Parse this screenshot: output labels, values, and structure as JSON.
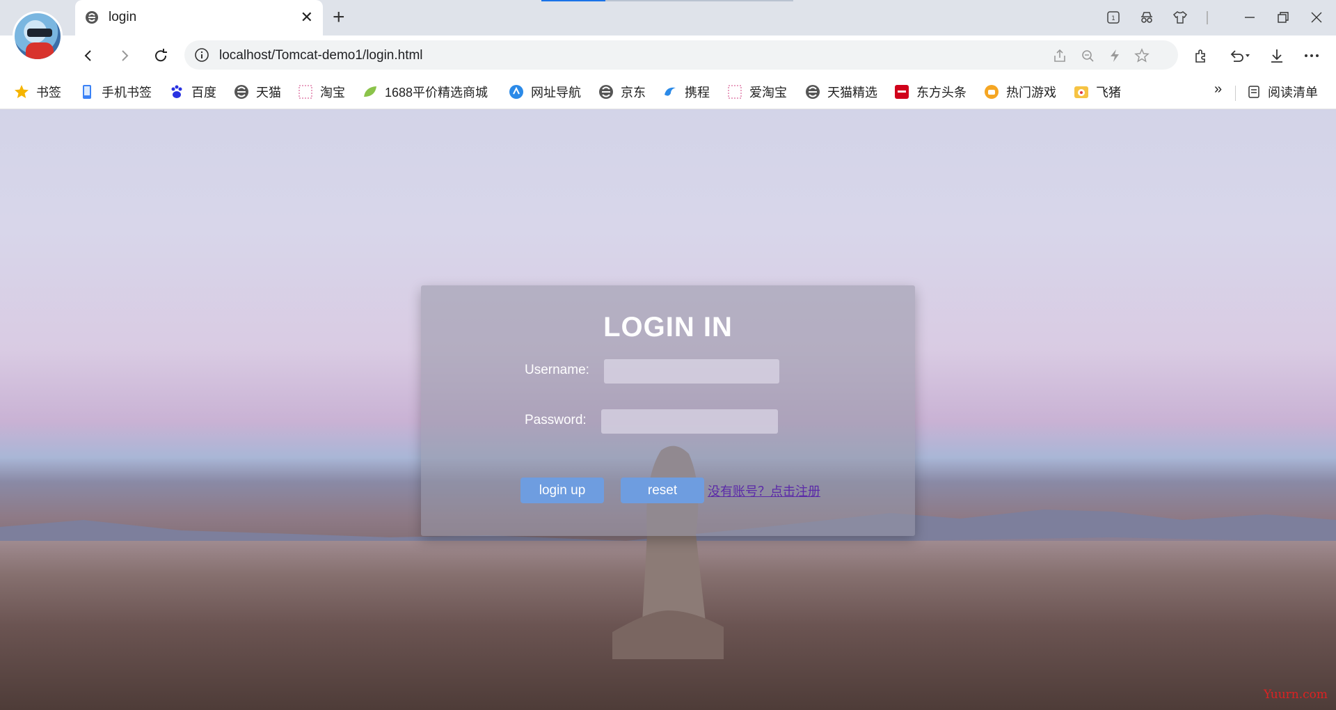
{
  "browser": {
    "tab": {
      "title": "login",
      "favicon": "edge-e-icon"
    },
    "address": {
      "url": "localhost/Tomcat-demo1/login.html"
    },
    "window_controls": [
      "minimize",
      "restore",
      "close"
    ]
  },
  "bookmarks": {
    "items": [
      {
        "label": "书签",
        "icon": "star-icon",
        "color": "#f5b400"
      },
      {
        "label": "手机书签",
        "icon": "phone-icon",
        "color": "#3b82f6"
      },
      {
        "label": "百度",
        "icon": "baidu-paw-icon",
        "color": "#2932e1"
      },
      {
        "label": "天猫",
        "icon": "edge-e-icon",
        "color": "#555555"
      },
      {
        "label": "淘宝",
        "icon": "placeholder-icon",
        "color": "#e8a0c0"
      },
      {
        "label": "1688平价精选商城",
        "icon": "leaf-icon",
        "color": "#8bc34a"
      },
      {
        "label": "网址导航",
        "icon": "nav-icon",
        "color": "#2b8ae8"
      },
      {
        "label": "京东",
        "icon": "edge-e-icon",
        "color": "#555555"
      },
      {
        "label": "携程",
        "icon": "dolphin-icon",
        "color": "#2b8ae8"
      },
      {
        "label": "爱淘宝",
        "icon": "placeholder-icon",
        "color": "#e8a0c0"
      },
      {
        "label": "天猫精选",
        "icon": "edge-e-icon",
        "color": "#555555"
      },
      {
        "label": "东方头条",
        "icon": "dongfang-icon",
        "color": "#d0021b"
      },
      {
        "label": "热门游戏",
        "icon": "game-icon",
        "color": "#f5a623"
      },
      {
        "label": "飞猪",
        "icon": "feizhu-icon",
        "color": "#f6c343"
      }
    ],
    "more": "»",
    "reading_list": "阅读清单"
  },
  "login": {
    "title": "LOGIN IN",
    "username_label": "Username:",
    "password_label": "Password:",
    "username_value": "",
    "password_value": "",
    "login_button": "login up",
    "reset_button": "reset",
    "register_link": "没有账号？点击注册"
  },
  "watermark": "Yuurn.com",
  "colors": {
    "button": "#6e9de0",
    "link": "#5b2aa8",
    "card": "rgba(150,150,165,0.55)"
  }
}
